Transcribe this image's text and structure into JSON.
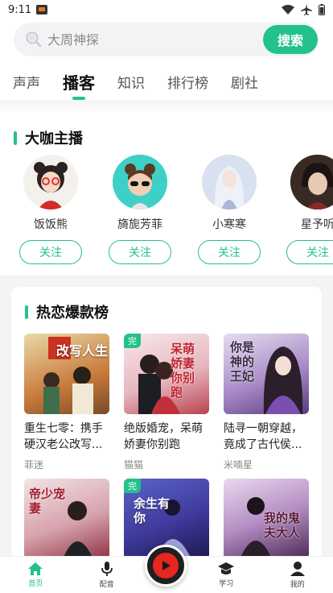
{
  "status_bar": {
    "time": "9:11"
  },
  "search": {
    "placeholder": "大周神探",
    "button_label": "搜索"
  },
  "tabs": [
    {
      "label": "声声"
    },
    {
      "label": "播客"
    },
    {
      "label": "知识"
    },
    {
      "label": "排行榜"
    },
    {
      "label": "剧社"
    }
  ],
  "active_tab": "播客",
  "hosts_section": {
    "title": "大咖主播",
    "hosts": [
      {
        "name": "饭饭熊",
        "follow_label": "关注"
      },
      {
        "name": "旖旎芳菲",
        "follow_label": "关注"
      },
      {
        "name": "小寒寒",
        "follow_label": "关注"
      },
      {
        "name": "星予听",
        "follow_label": "关注"
      }
    ]
  },
  "hot_section": {
    "title": "热恋爆款榜",
    "books": [
      {
        "title": "重生七零：携手硬汉老公改写...",
        "author": "菲迷",
        "badge": "",
        "cover_text": "改写人生"
      },
      {
        "title": "绝版婚宠，呆萌娇妻你别跑",
        "author": "猫猫",
        "badge": "完",
        "cover_text": "呆萌娇妻你别跑"
      },
      {
        "title": "陆寻一朝穿越，竟成了古代侯...",
        "author": "米喃星",
        "badge": "",
        "cover_text": "你是神的王妃"
      },
      {
        "title": "",
        "author": "",
        "badge": "",
        "cover_text": "帝少宠妻"
      },
      {
        "title": "",
        "author": "",
        "badge": "完",
        "cover_text": "余生有你"
      },
      {
        "title": "",
        "author": "",
        "badge": "",
        "cover_text": "我的鬼夫大人"
      }
    ]
  },
  "bottom_nav": [
    {
      "label": "首页"
    },
    {
      "label": "配音"
    },
    {
      "label": "学习"
    },
    {
      "label": "我的"
    }
  ],
  "colors": {
    "accent": "#23c28a",
    "play_button": "#e8261f"
  }
}
